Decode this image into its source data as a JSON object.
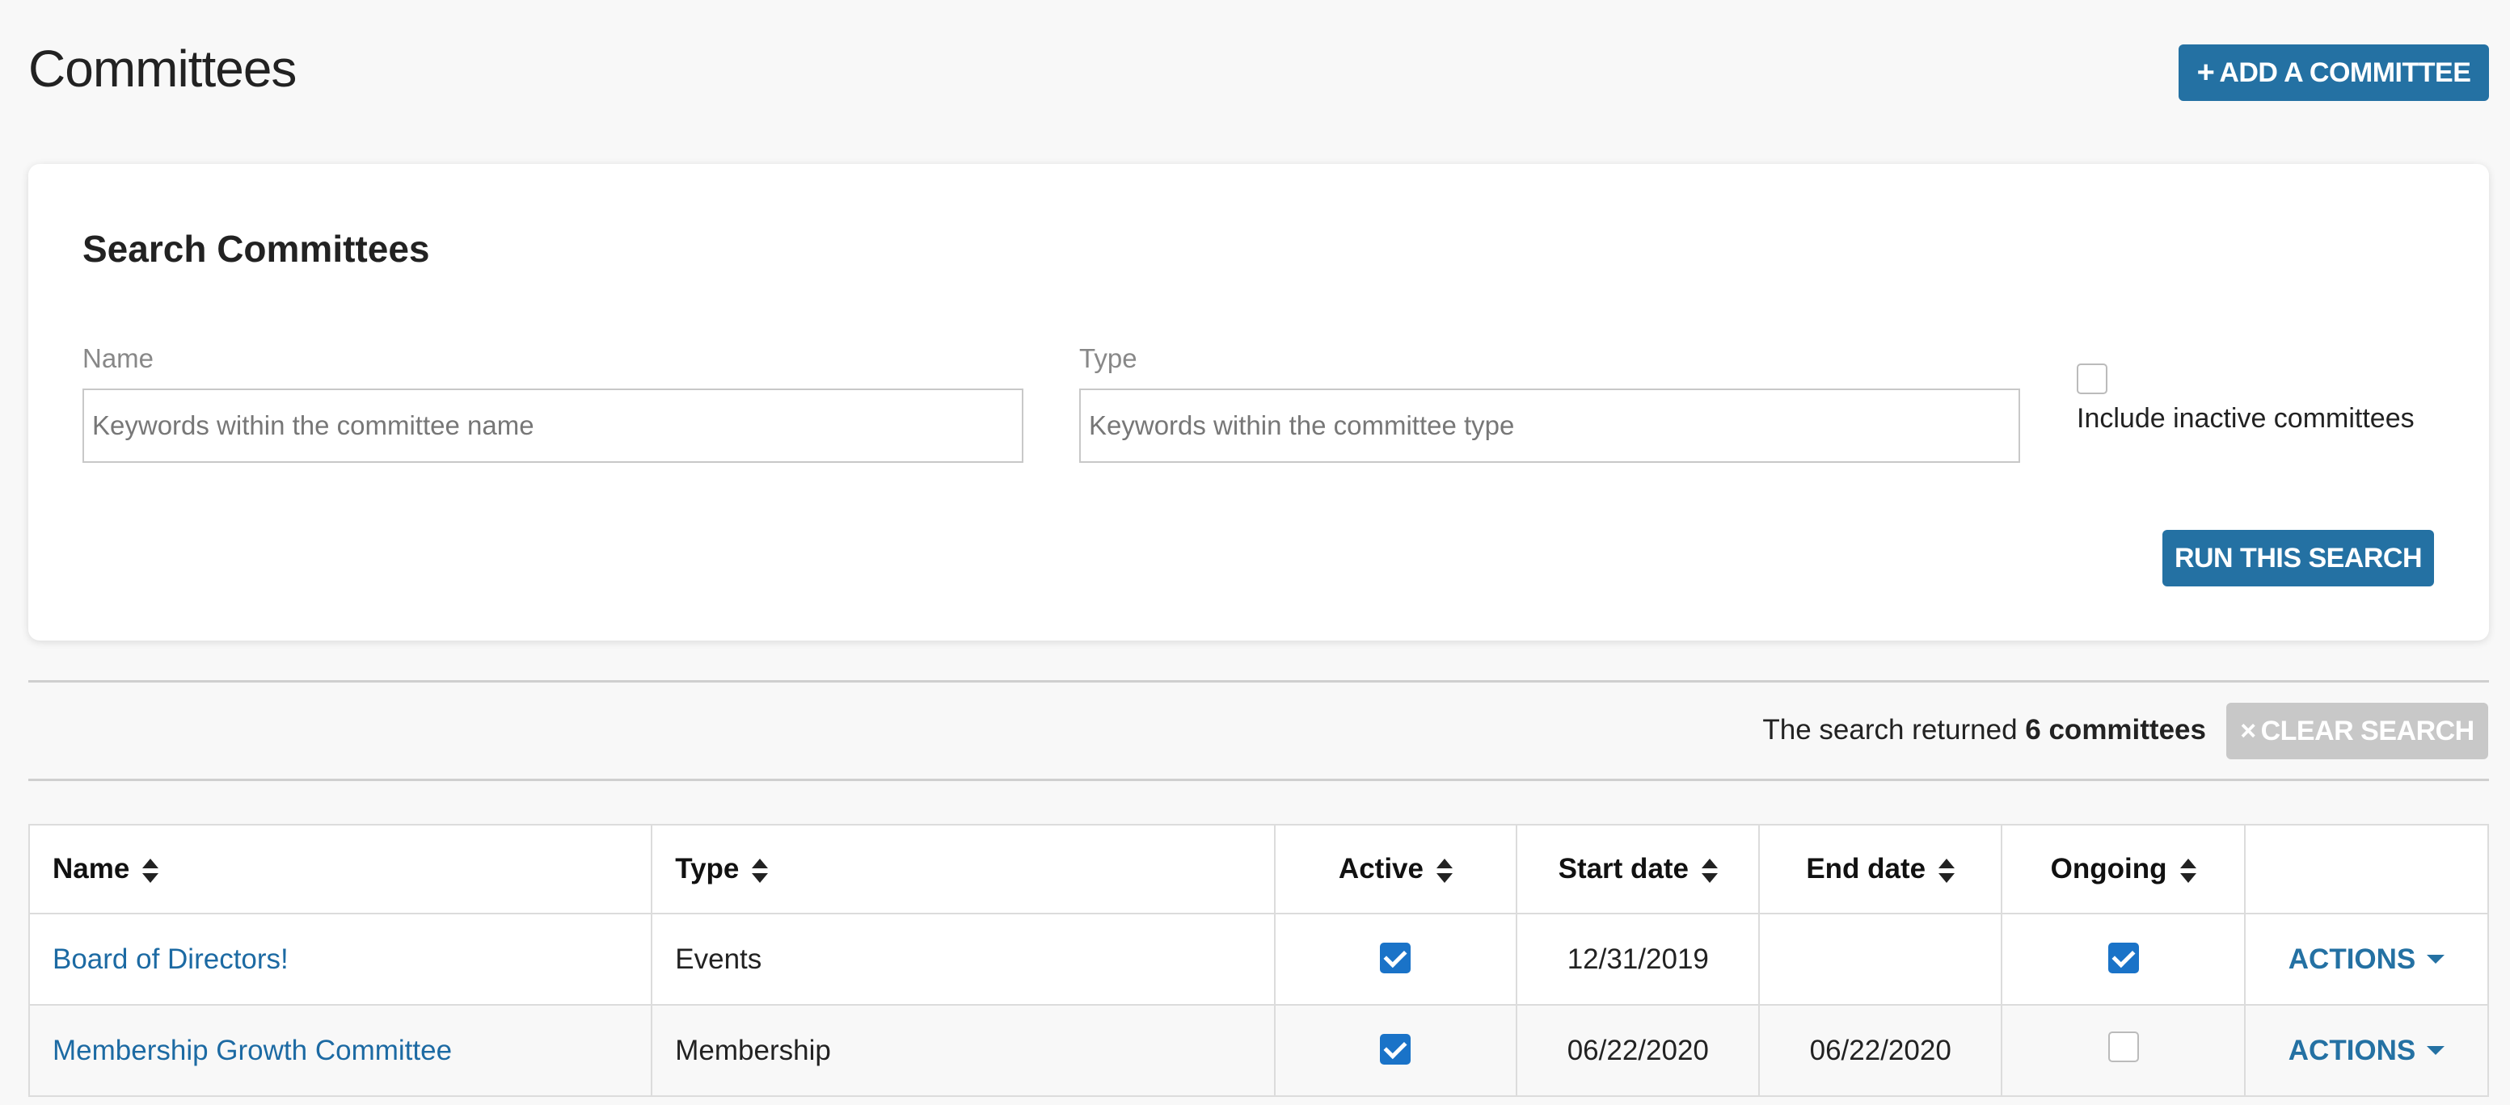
{
  "page": {
    "title": "Committees"
  },
  "header": {
    "add_label": "ADD A COMMITTEE",
    "add_icon": "+"
  },
  "search": {
    "title": "Search Committees",
    "name_label": "Name",
    "name_placeholder": "Keywords within the committee name",
    "type_label": "Type",
    "type_placeholder": "Keywords within the committee type",
    "inactive_label": "Include inactive committees",
    "run_label": "RUN THIS SEARCH"
  },
  "results": {
    "prefix": "The search returned",
    "count_text": "6 committees",
    "clear_label": "CLEAR SEARCH",
    "clear_icon": "×"
  },
  "table": {
    "headers": {
      "name": "Name",
      "type": "Type",
      "active": "Active",
      "start": "Start date",
      "end": "End date",
      "ongoing": "Ongoing"
    },
    "actions_label": "ACTIONS",
    "rows": [
      {
        "name": "Board of Directors!",
        "type": "Events",
        "active": true,
        "start": "12/31/2019",
        "end": "",
        "ongoing": true
      },
      {
        "name": "Membership Growth Committee",
        "type": "Membership",
        "active": true,
        "start": "06/22/2020",
        "end": "06/22/2020",
        "ongoing": false
      }
    ]
  },
  "colors": {
    "primary": "#2471a3",
    "link": "#1c6aa3",
    "checkbox": "#1a73c8"
  }
}
